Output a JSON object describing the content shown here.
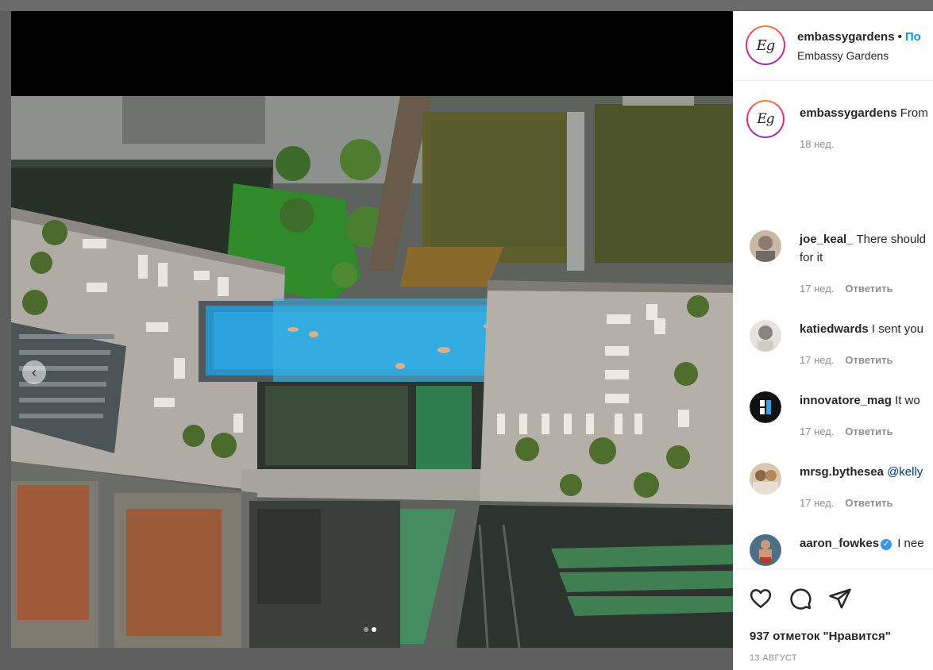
{
  "post": {
    "account": {
      "username": "embassygardens",
      "separator": "•",
      "follow_label": "По",
      "location": "Embassy Gardens",
      "logo_text": "Eg"
    },
    "caption": {
      "username": "embassygardens",
      "text": "From",
      "time": "18 нед."
    },
    "comments": [
      {
        "username": "joe_keal_",
        "text": "There should",
        "text_line2": "for it",
        "time": "17 нед.",
        "reply_label": "Ответить",
        "verified": false
      },
      {
        "username": "katiedwards",
        "text": "I sent you",
        "time": "17 нед.",
        "reply_label": "Ответить",
        "verified": false
      },
      {
        "username": "innovatore_mag",
        "text": "It wo",
        "time": "17 нед.",
        "reply_label": "Ответить",
        "verified": false
      },
      {
        "username": "mrsg.bythesea",
        "text": "@kelly",
        "time": "17 нед.",
        "reply_label": "Ответить",
        "verified": false
      },
      {
        "username": "aaron_fowkes",
        "text": "I nee",
        "verified": true,
        "verified_mark": "✓"
      }
    ],
    "likes_text": "937 отметок \"Нравится\"",
    "date_text": "13 АВГУСТ",
    "carousel": {
      "prev_icon": "chevron-left-icon",
      "total_slides": 2,
      "active_slide": 2
    },
    "icons": [
      "heart-icon",
      "comment-icon",
      "share-icon"
    ]
  }
}
